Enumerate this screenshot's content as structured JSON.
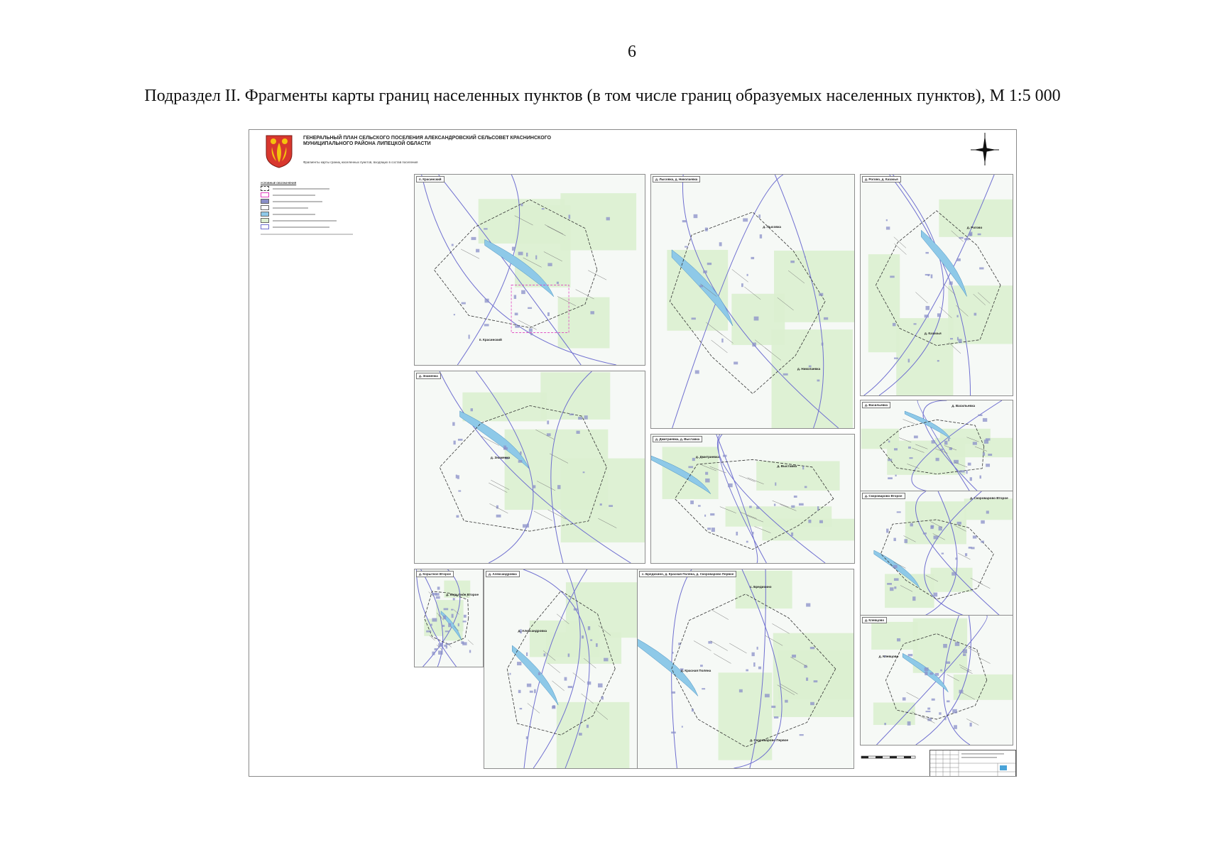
{
  "page_number": "6",
  "caption": "Подраздел II. Фрагменты карты границ населенных пунктов (в том числе границ образуемых населенных пунктов), М 1:5 000",
  "map_sheet": {
    "title": "ГЕНЕРАЛЬНЫЙ ПЛАН СЕЛЬСКОГО ПОСЕЛЕНИЯ АЛЕКСАНДРОВСКИЙ СЕЛЬСОВЕТ КРАСНИНСКОГО МУНИЦИПАЛЬНОГО РАЙОНА ЛИПЕЦКОЙ ОБЛАСТИ",
    "subtitle": "Фрагменты карты границ населенных пунктов, входящих в состав поселения",
    "legend_header": "УСЛОВНЫЕ ОБОЗНАЧЕНИЯ",
    "colors": {
      "farmland": "#dcefd0",
      "water": "#8ec9e8",
      "roads": "#6f6fd0",
      "boundary": "#333333",
      "planned_boundary": "#e040c0",
      "buildings": "#8a8fc8"
    },
    "fragments": [
      {
        "label": "п. Красинский",
        "places": [
          "п. Красинский"
        ]
      },
      {
        "label": "д. Лысовка, д. Николаевка",
        "places": [
          "д. Лысовка",
          "д. Николаевка"
        ]
      },
      {
        "label": "д. Рогово, д. Казачья",
        "places": [
          "д. Рогово",
          "д. Казачья"
        ]
      },
      {
        "label": "д. Знаменка",
        "places": [
          "д. Знаменка"
        ]
      },
      {
        "label": "д. Дмитриевка, д. Выставка",
        "places": [
          "д. Дмитриевка",
          "д. Выставка"
        ]
      },
      {
        "label": "д. Васильевка",
        "places": [
          "д. Васильевка"
        ]
      },
      {
        "label": "д. Скороварово Второе",
        "places": [
          "д. Скороварово Второе"
        ]
      },
      {
        "label": "д. Корытное Второе",
        "places": [
          "д. Корытное Второе"
        ]
      },
      {
        "label": "д. Александровка",
        "places": [
          "д. Александровка"
        ]
      },
      {
        "label": "с. Бредихино, д. Красная Поляна, д. Скороварово Первое",
        "places": [
          "с. Бредихино",
          "д. Красная Поляна",
          "д. Скороварово Первое"
        ]
      },
      {
        "label": "д. Клевцово",
        "places": [
          "д. Клевцово"
        ]
      }
    ]
  }
}
